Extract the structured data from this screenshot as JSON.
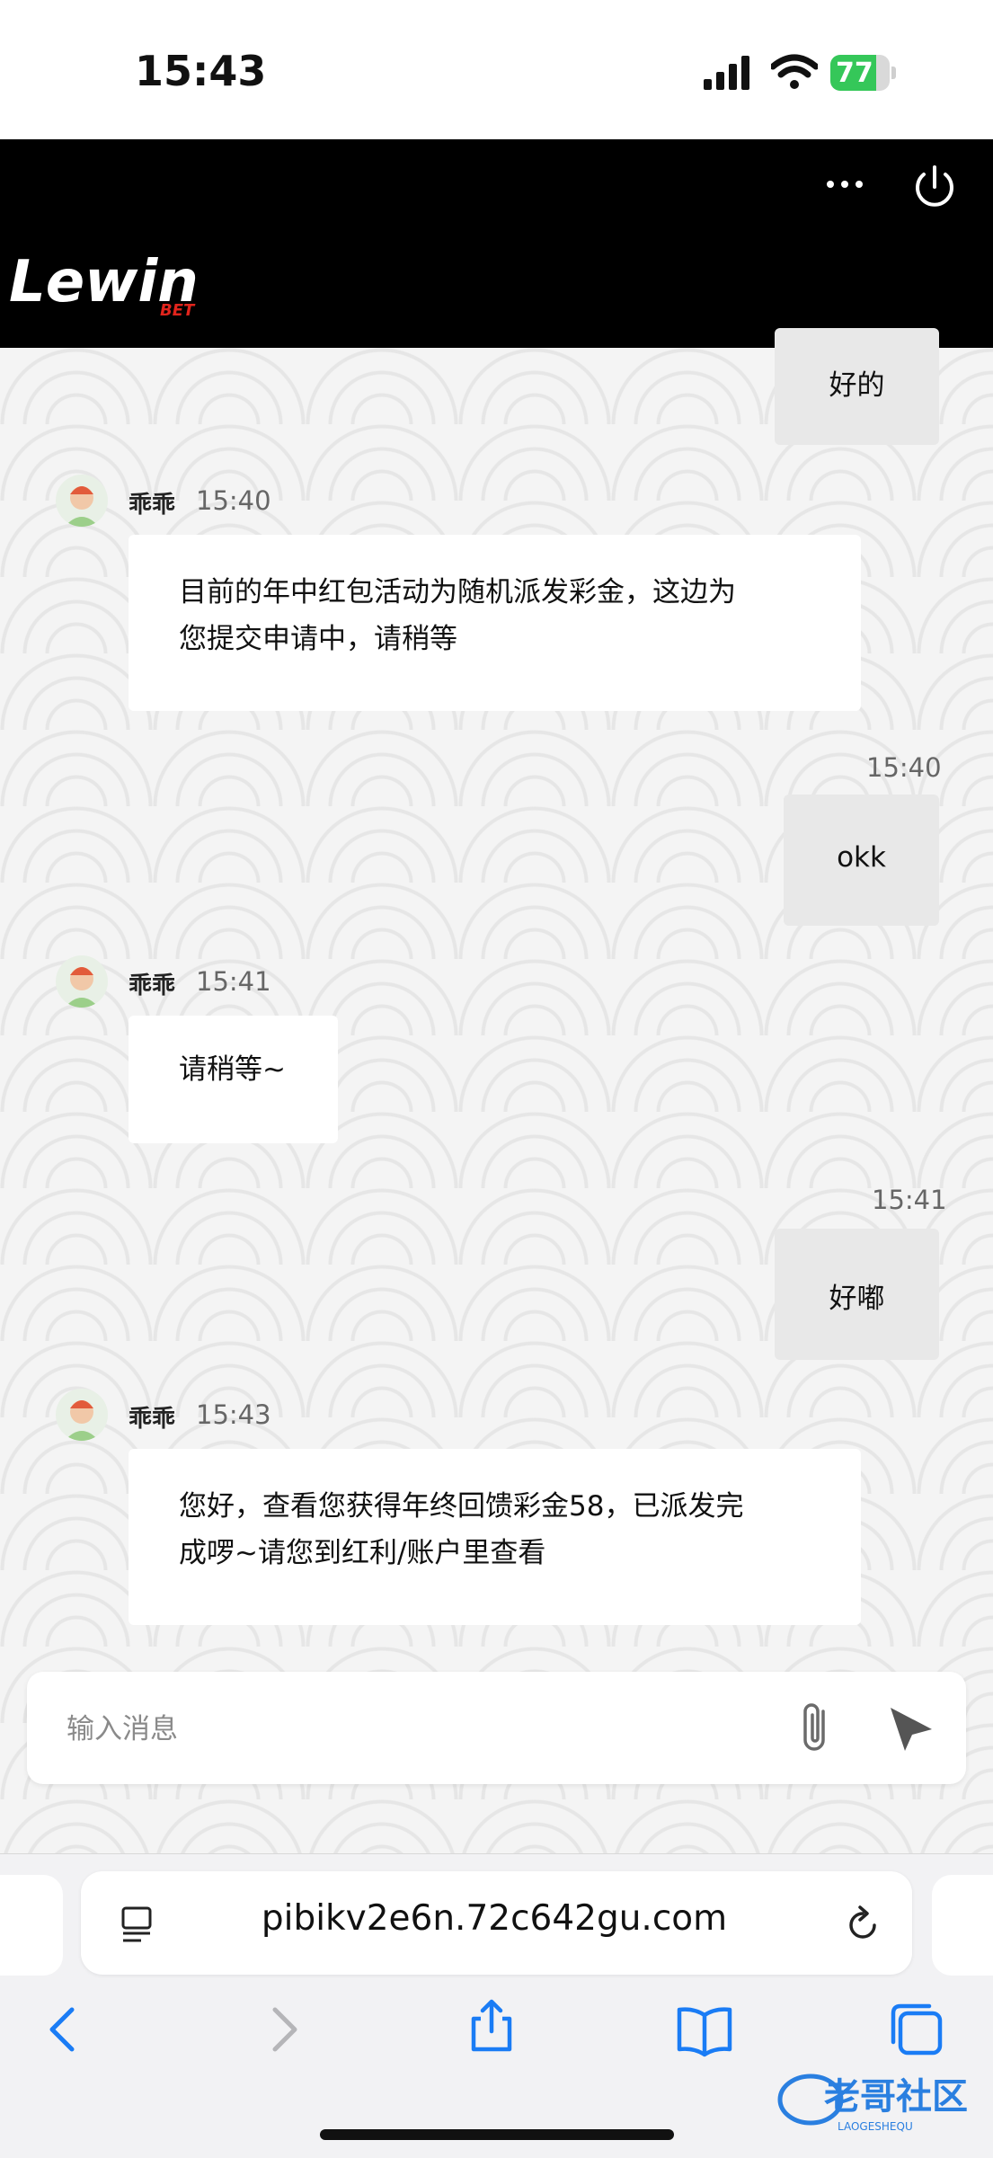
{
  "status_bar": {
    "time": "15:43",
    "battery": "77",
    "battery_level": 0.77
  },
  "header": {
    "brand": "Lewin",
    "brand_sub": "BET"
  },
  "messages": [
    {
      "direction": "out",
      "text": "好的"
    },
    {
      "direction": "in",
      "sender": "乖乖",
      "time": "15:40",
      "lines": [
        "目前的年中红包活动为随机派发彩金，这边为",
        "您提交申请中，请稍等"
      ]
    },
    {
      "direction": "out",
      "time": "15:40",
      "text": "okk"
    },
    {
      "direction": "in",
      "sender": "乖乖",
      "time": "15:41",
      "lines": [
        "请稍等~"
      ]
    },
    {
      "direction": "out",
      "time": "15:41",
      "text": "好嘟"
    },
    {
      "direction": "in",
      "sender": "乖乖",
      "time": "15:43",
      "lines": [
        "您好，查看您获得年终回馈彩金58，已派发完",
        "成啰~请您到红利/账户里查看"
      ]
    }
  ],
  "input": {
    "placeholder": "输入消息"
  },
  "browser": {
    "url": "pibikv2e6n.72c642gu.com"
  },
  "watermark": {
    "text": "老哥社区",
    "sub": "LAOGESHEQU"
  },
  "colors": {
    "header_bg": "#000000",
    "brand_red": "#e1241c",
    "battery_green": "#35c759",
    "accent_blue": "#1a7cf5"
  }
}
